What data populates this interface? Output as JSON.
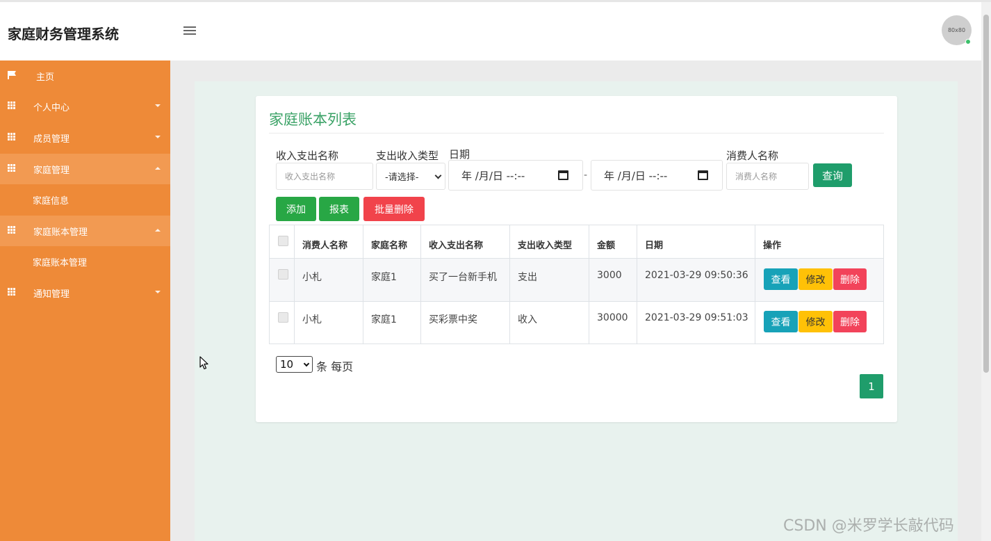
{
  "app": {
    "title": "家庭财务管理系统",
    "avatar_text": "80x80"
  },
  "sidebar": {
    "items": [
      {
        "label": "主页",
        "icon": "flag-icon"
      },
      {
        "label": "个人中心",
        "icon": "grid-icon"
      },
      {
        "label": "成员管理",
        "icon": "grid-icon"
      },
      {
        "label": "家庭管理",
        "icon": "grid-icon",
        "expanded": true
      },
      {
        "label": "家庭信息",
        "sub": true
      },
      {
        "label": "家庭账本管理",
        "icon": "grid-icon",
        "expanded": true
      },
      {
        "label": "家庭账本管理",
        "sub": true
      },
      {
        "label": "通知管理",
        "icon": "grid-icon"
      }
    ]
  },
  "main": {
    "card_title": "家庭账本列表",
    "filters": {
      "name_label": "收入支出名称",
      "name_placeholder": "收入支出名称",
      "type_label": "支出收入类型",
      "type_selected": "-请选择-",
      "date_label": "日期",
      "date_placeholder": "年 /月/日 --:--",
      "date_separator": "-",
      "consumer_label": "消费人名称",
      "consumer_placeholder": "消费人名称",
      "query_button": "查询"
    },
    "actions": {
      "add": "添加",
      "report": "报表",
      "batch_delete": "批量删除"
    },
    "table": {
      "headers": [
        "消费人名称",
        "家庭名称",
        "收入支出名称",
        "支出收入类型",
        "金额",
        "日期",
        "操作"
      ],
      "rows": [
        {
          "consumer": "小札",
          "family": "家庭1",
          "name": "买了一台新手机",
          "type": "支出",
          "amount": "3000",
          "date": "2021-03-29 09:50:36"
        },
        {
          "consumer": "小札",
          "family": "家庭1",
          "name": "买彩票中奖",
          "type": "收入",
          "amount": "30000",
          "date": "2021-03-29 09:51:03"
        }
      ],
      "row_actions": {
        "view": "查看",
        "edit": "修改",
        "delete": "删除"
      }
    },
    "pagination": {
      "page_size": "10",
      "page_size_suffix": "条 每页",
      "current_page": "1"
    }
  },
  "watermark": "CSDN @米罗学长敲代码",
  "colors": {
    "sidebar": "#ee8a38",
    "accent_green": "#1f9d6b",
    "title_green": "#3aa266",
    "danger": "#f1434b"
  }
}
